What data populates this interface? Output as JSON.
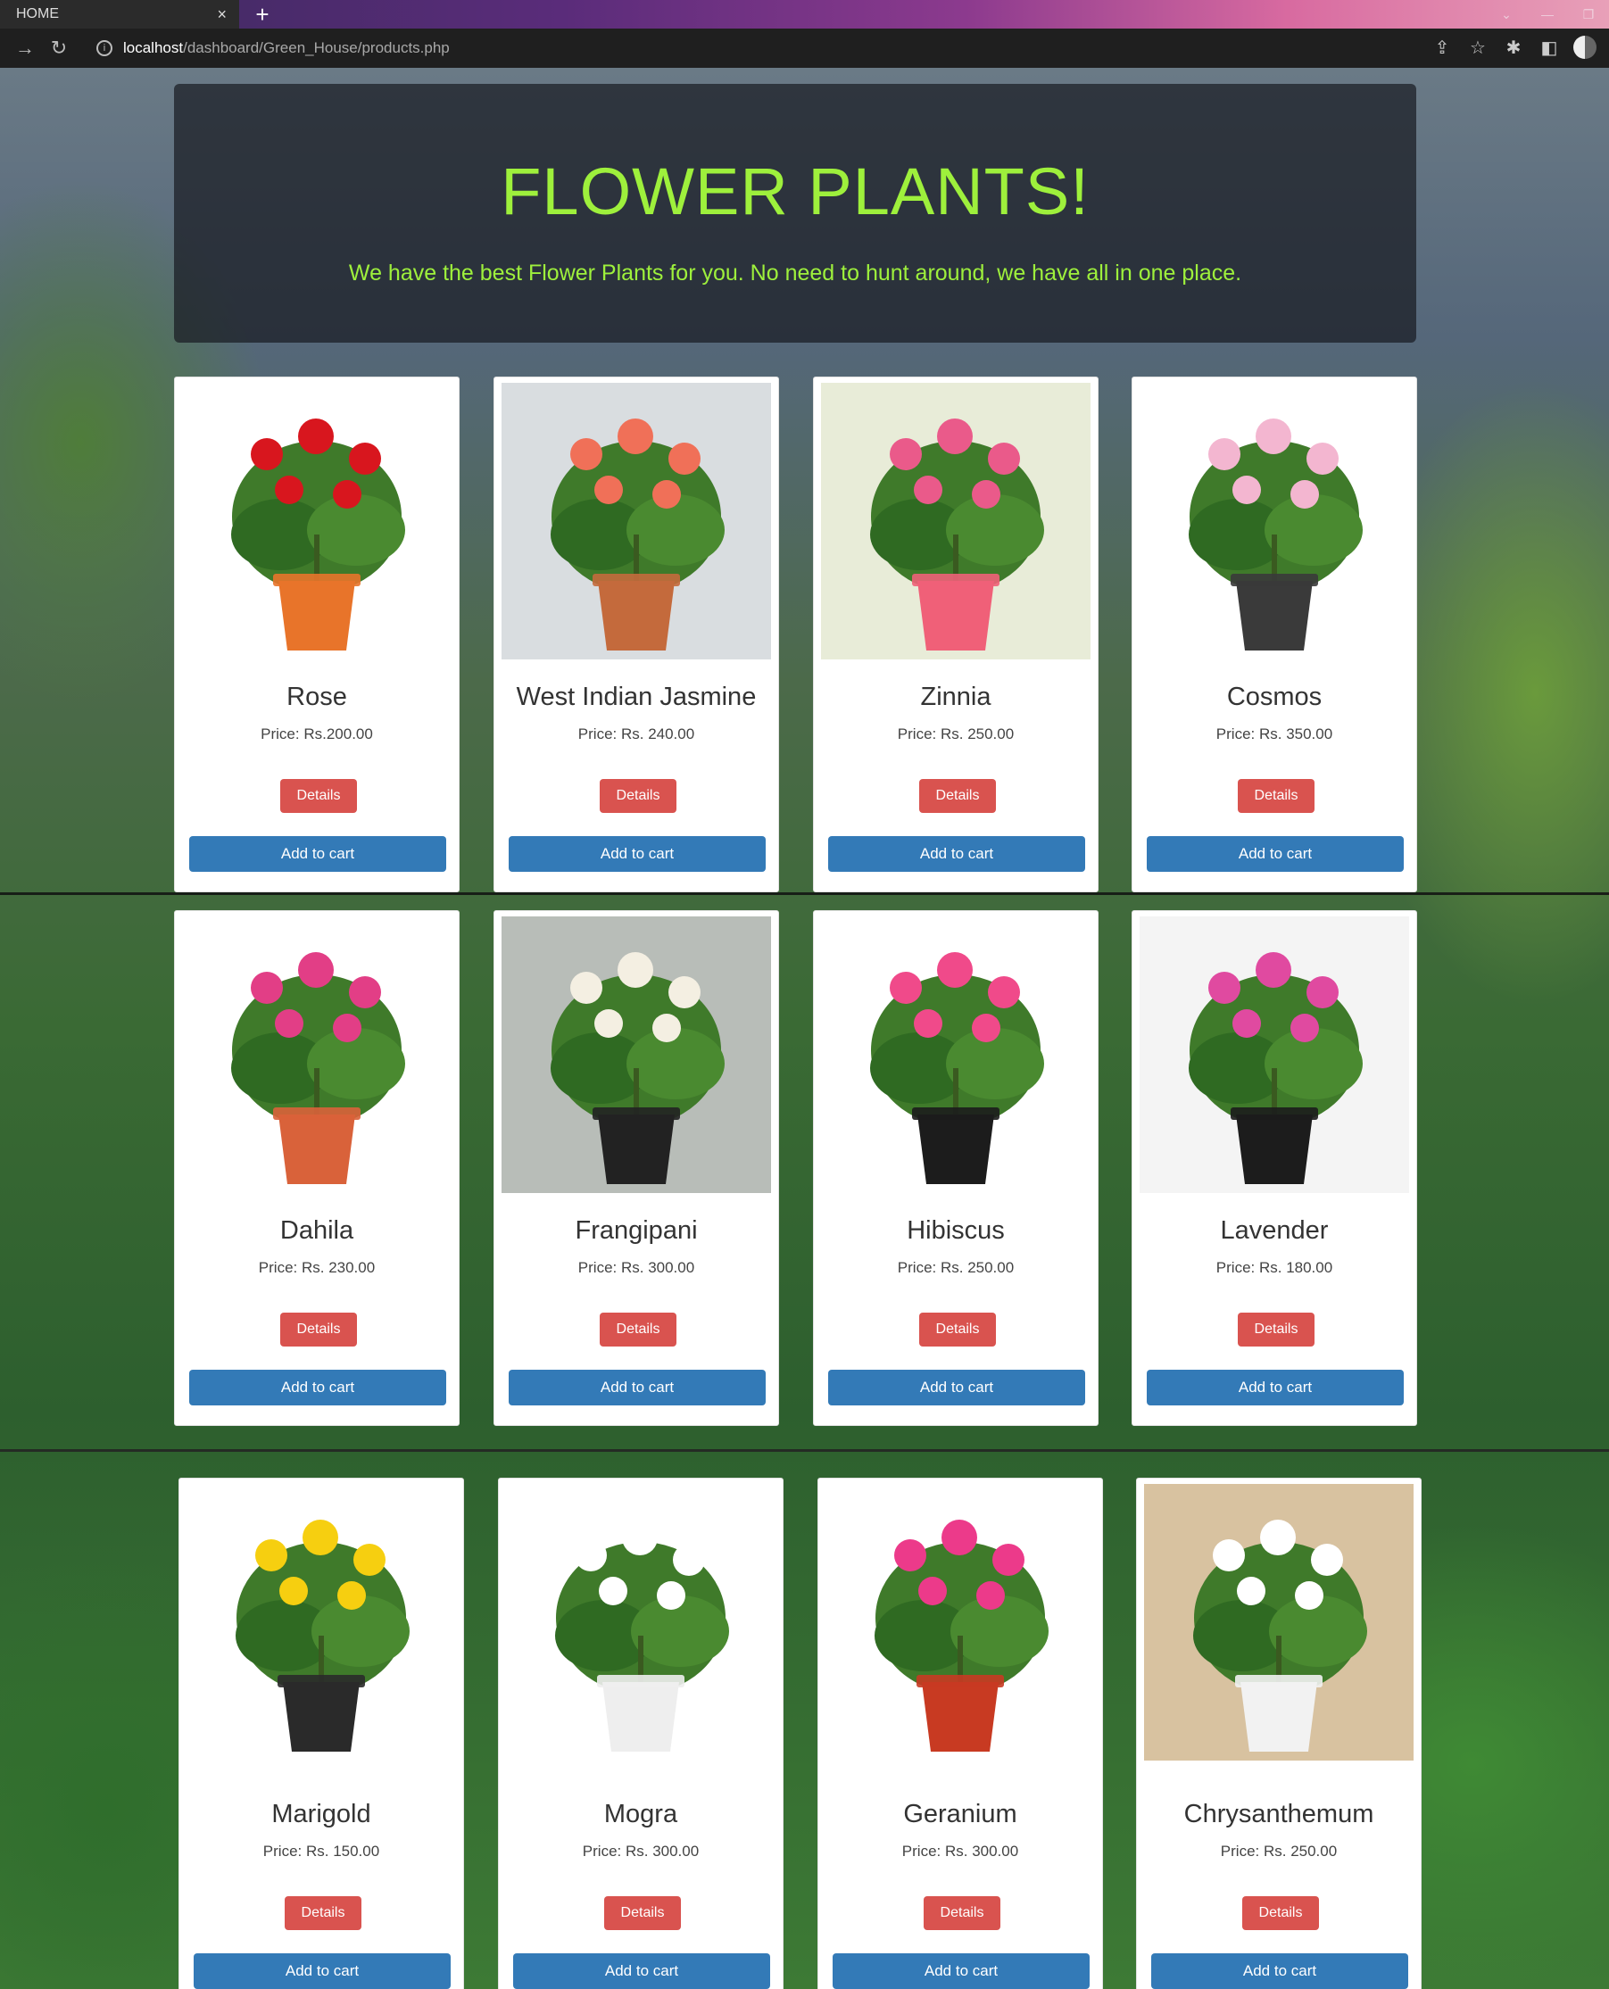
{
  "browser": {
    "tab_title": "HOME",
    "tab_close": "×",
    "new_tab": "+",
    "url_host": "localhost",
    "url_path": "/dashboard/Green_House/products.php",
    "colors": {
      "chrome_bg": "#1f1f1f",
      "tab_bg": "#2b2b2b"
    }
  },
  "hero": {
    "title": "FLOWER PLANTS!",
    "subtitle": "We have the best Flower Plants for you. No need to hunt around, we have all in one place.",
    "color": "#9ef03c"
  },
  "buttons": {
    "details": "Details",
    "cart": "Add to cart",
    "details_color": "#d9534f",
    "cart_color": "#337ab7"
  },
  "products": [
    {
      "name": "Rose",
      "price": "Price: Rs.200.00",
      "flower": "#d8161e",
      "pot": "#e8742a",
      "bg": "#ffffff"
    },
    {
      "name": "West Indian Jasmine",
      "price": "Price: Rs. 240.00",
      "flower": "#f07058",
      "pot": "#c46a3c",
      "bg": "#d9dde0"
    },
    {
      "name": "Zinnia",
      "price": "Price: Rs. 250.00",
      "flower": "#ea5a8a",
      "pot": "#f06078",
      "bg": "#e8ecd8"
    },
    {
      "name": "Cosmos",
      "price": "Price: Rs. 350.00",
      "flower": "#f3b6d0",
      "pot": "#3a3a3a",
      "bg": "#ffffff"
    },
    {
      "name": "Dahila",
      "price": "Price: Rs. 230.00",
      "flower": "#e23e86",
      "pot": "#d9623a",
      "bg": "#ffffff"
    },
    {
      "name": "Frangipani",
      "price": "Price: Rs. 300.00",
      "flower": "#f4efe2",
      "pot": "#222222",
      "bg": "#b8bdb8"
    },
    {
      "name": "Hibiscus",
      "price": "Price: Rs. 250.00",
      "flower": "#f04a8a",
      "pot": "#1c1c1c",
      "bg": "#ffffff"
    },
    {
      "name": "Lavender",
      "price": "Price: Rs. 180.00",
      "flower": "#e04aa0",
      "pot": "#1c1c1c",
      "bg": "#f4f4f4"
    },
    {
      "name": "Marigold",
      "price": "Price: Rs. 150.00",
      "flower": "#f6cf10",
      "pot": "#2a2a2a",
      "bg": "#ffffff"
    },
    {
      "name": "Mogra",
      "price": "Price: Rs. 300.00",
      "flower": "#ffffff",
      "pot": "#eeeeee",
      "bg": "#ffffff"
    },
    {
      "name": "Geranium",
      "price": "Price: Rs. 300.00",
      "flower": "#ec3a8a",
      "pot": "#c83a22",
      "bg": "#ffffff"
    },
    {
      "name": "Chrysanthemum",
      "price": "Price: Rs. 250.00",
      "flower": "#ffffff",
      "pot": "#f2f2f2",
      "bg": "#d8c2a0"
    }
  ]
}
